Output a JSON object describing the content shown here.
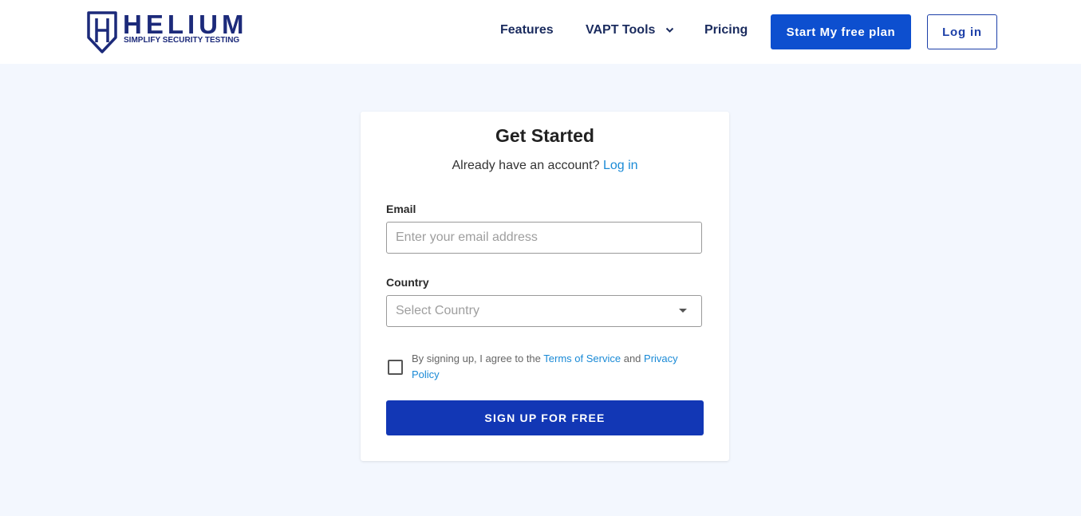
{
  "brand": {
    "name": "HELIUM",
    "tagline": "SIMPLIFY SECURITY TESTING",
    "color": "#1c2a7a",
    "icon": "shield-icon"
  },
  "nav": {
    "features": "Features",
    "vapt_tools": "VAPT Tools",
    "vapt_icon": "chevron-down-icon",
    "pricing": "Pricing",
    "start_plan": "Start My free plan",
    "login": "Log in"
  },
  "form": {
    "title": "Get Started",
    "account_prompt": "Already have an account?",
    "account_link": "Log in",
    "email_label": "Email",
    "email_placeholder": "Enter your email address",
    "email_value": "",
    "country_label": "Country",
    "country_placeholder": "Select Country",
    "terms_prefix": "By signing up, I agree to the",
    "terms_link": "Terms of Service",
    "terms_and": "and",
    "privacy_link_1": "Privacy",
    "privacy_link_2": "Policy",
    "agree_checked": false,
    "submit": "SIGN UP FOR FREE"
  },
  "colors": {
    "primary": "#0d4fcf",
    "submit": "#1237b5",
    "link": "#1a8ad6",
    "background": "#f3f7fe"
  }
}
